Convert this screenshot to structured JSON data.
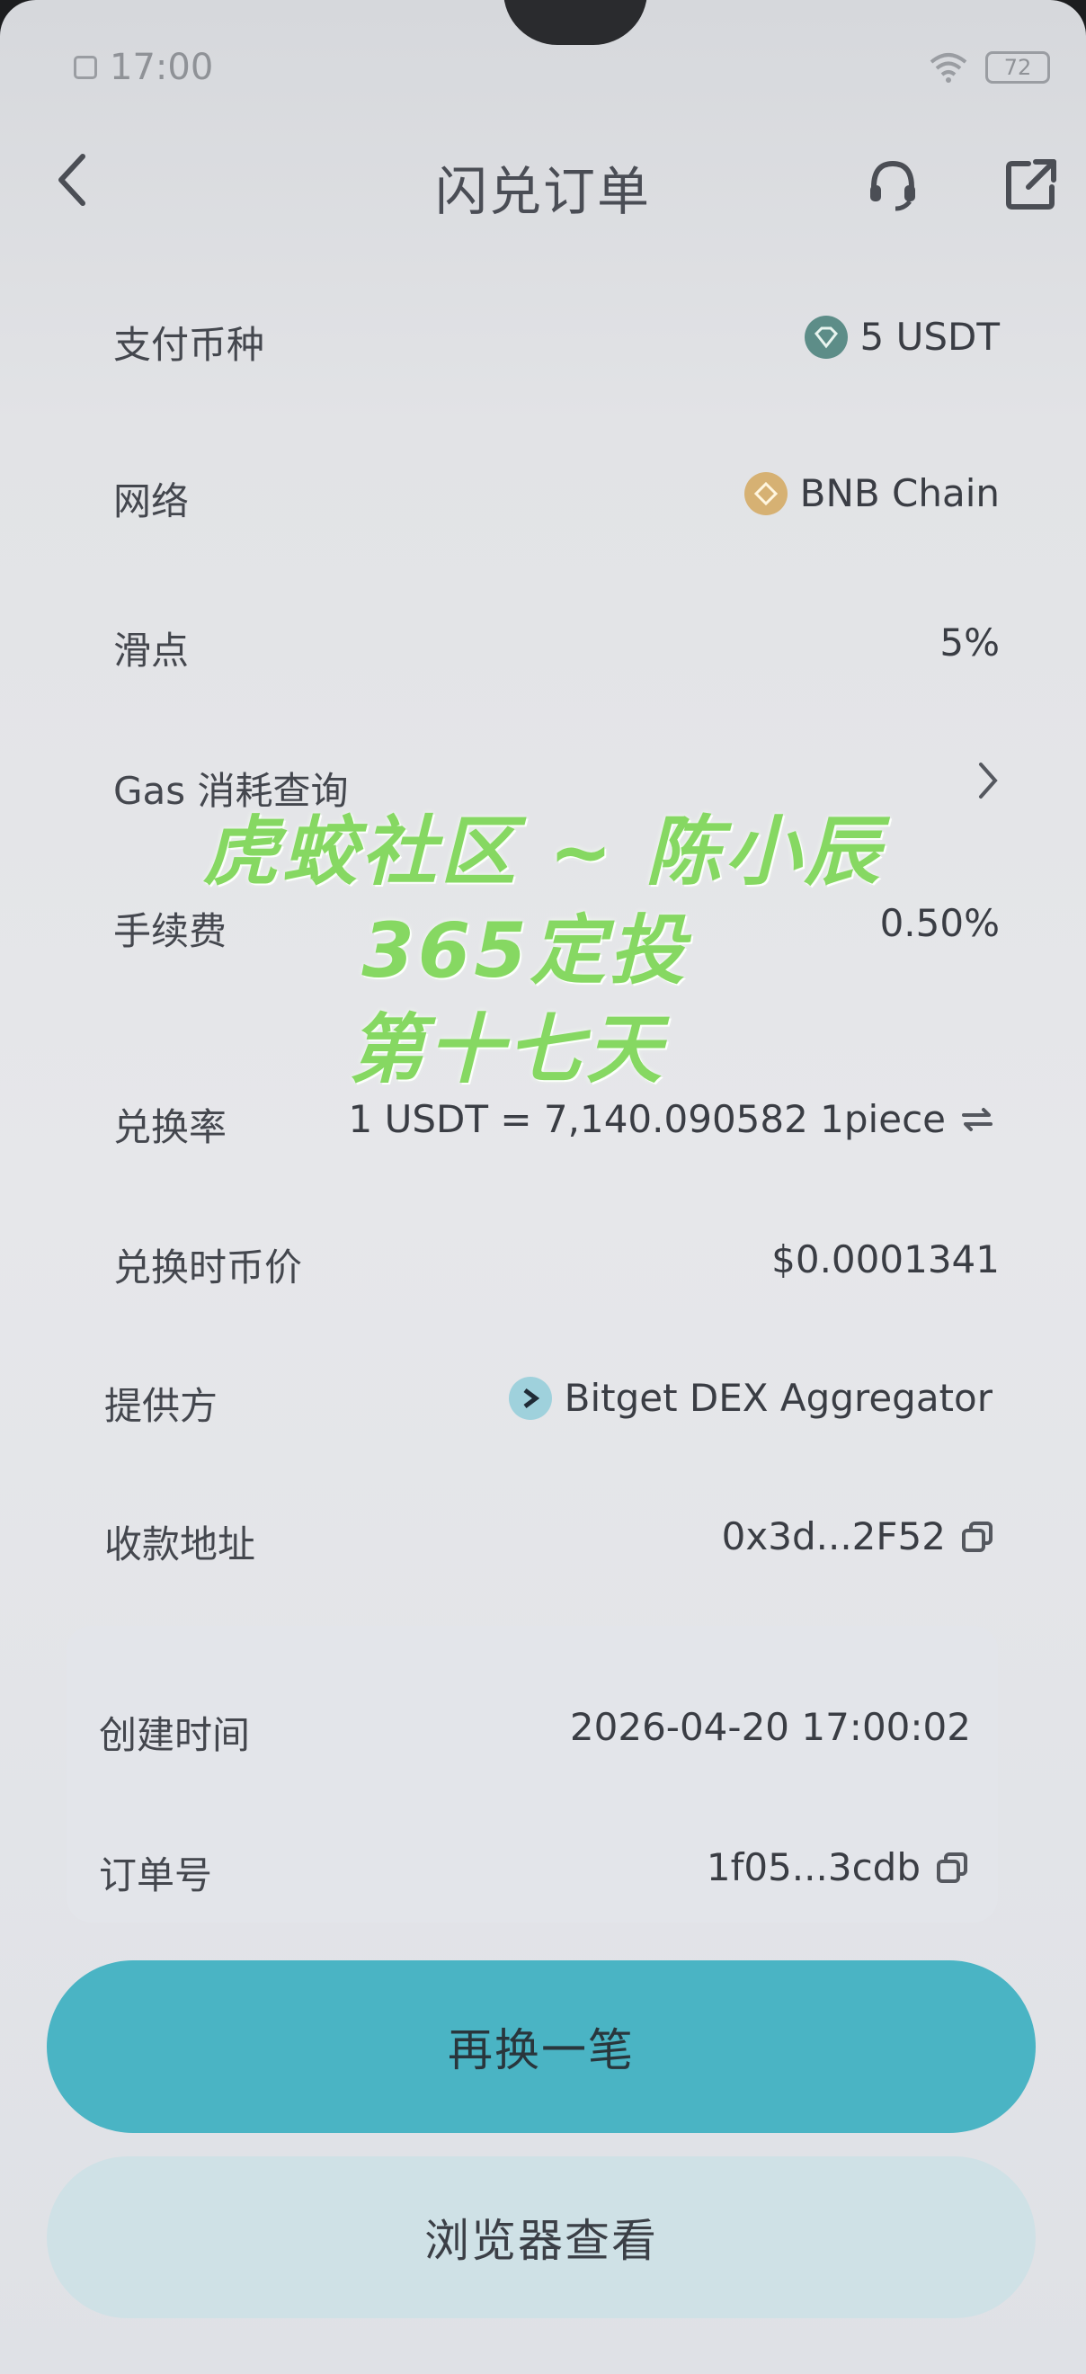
{
  "status_bar": {
    "time": "17:00",
    "battery": "72"
  },
  "header": {
    "title": "闪兑订单"
  },
  "rows": {
    "pay_currency": {
      "label": "支付币种",
      "value": "5 USDT"
    },
    "network": {
      "label": "网络",
      "value": "BNB Chain"
    },
    "slippage": {
      "label": "滑点",
      "value": "5%"
    },
    "gas": {
      "label": "Gas 消耗查询"
    },
    "fee": {
      "label": "手续费",
      "value": "0.50%"
    },
    "rate": {
      "label": "兑换率",
      "value": "1 USDT = 7,140.090582 1piece"
    },
    "price": {
      "label": "兑换时币价",
      "value": "$0.0001341"
    },
    "provider": {
      "label": "提供方",
      "value": "Bitget DEX Aggregator"
    },
    "address": {
      "label": "收款地址",
      "value": "0x3d...2F52"
    }
  },
  "order_card": {
    "created_label": "创建时间",
    "created_value": "2026-04-20 17:00:02",
    "order_label": "订单号",
    "order_value": "1f05...3cdb"
  },
  "buttons": {
    "swap_again": "再换一笔",
    "view_explorer": "浏览器查看"
  },
  "watermark": {
    "line1": "虎蛟社区 ~ 陈小辰",
    "line2": "365定投",
    "line3": "第十七天"
  },
  "colors": {
    "accent": "#4ab4c4",
    "watermark": "#86d862"
  },
  "icons": [
    "back-icon",
    "support-icon",
    "share-icon",
    "usdt-coin-icon",
    "bnb-coin-icon",
    "chevron-right-icon",
    "swap-icon",
    "bitget-icon",
    "copy-icon"
  ]
}
